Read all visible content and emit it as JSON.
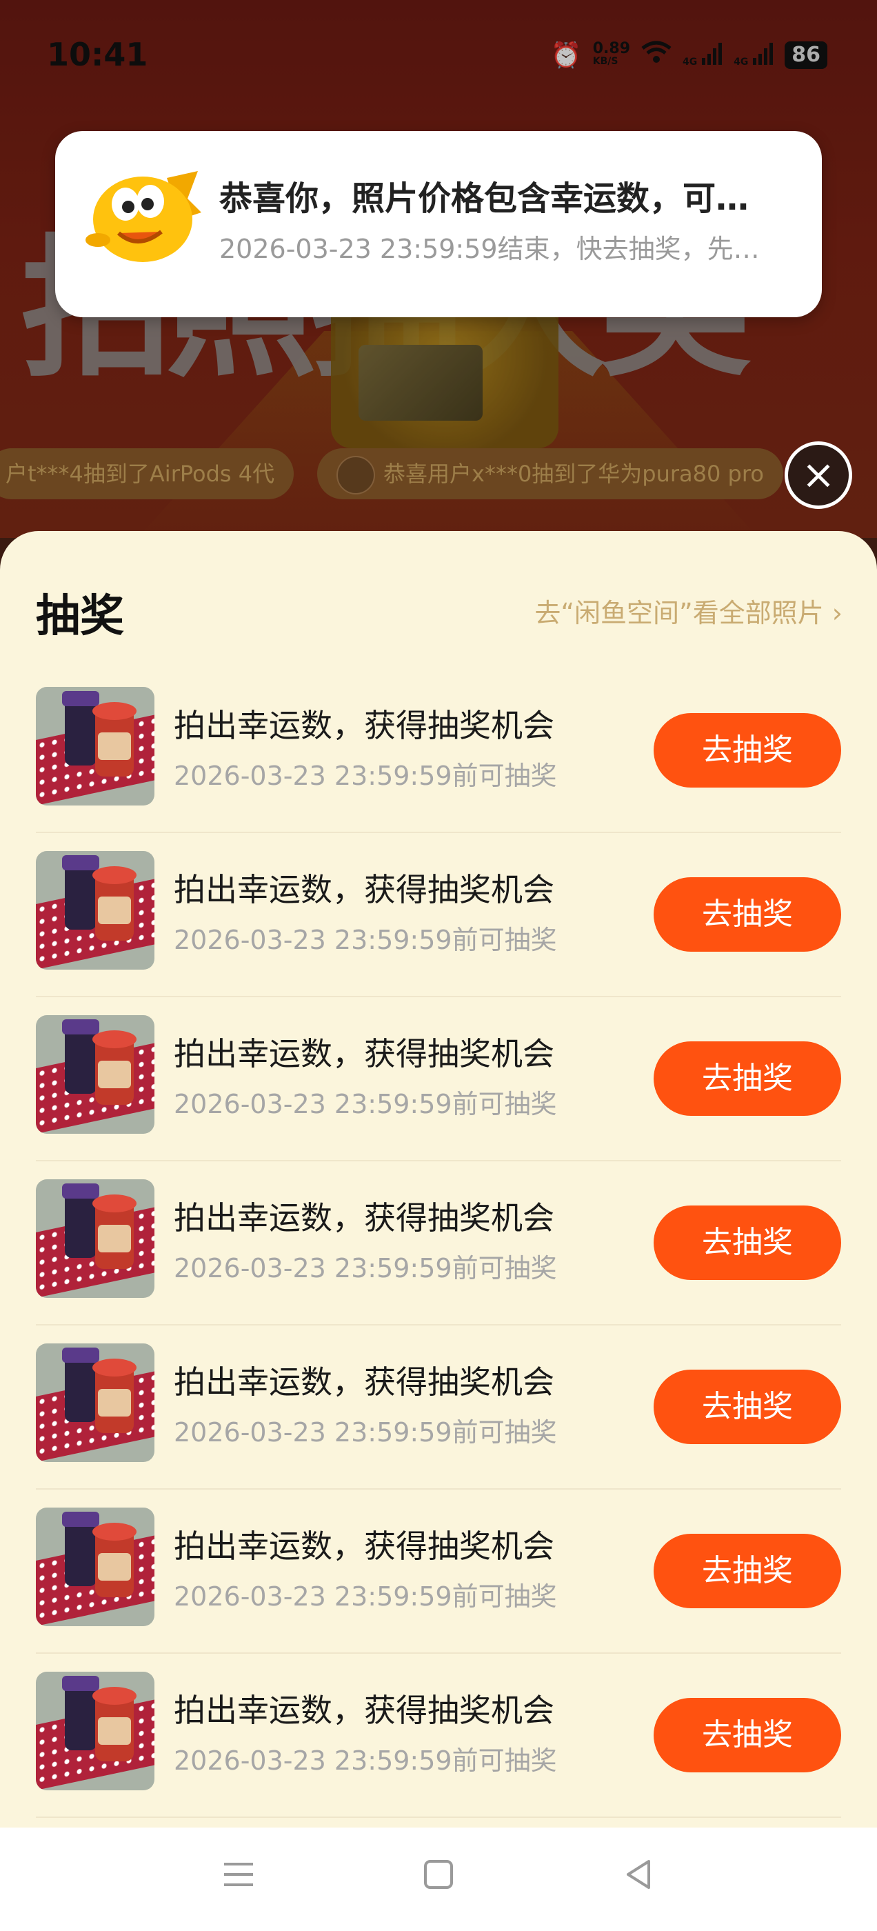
{
  "status_bar": {
    "time": "10:41",
    "speed_value": "0.89",
    "speed_unit": "KB/S",
    "net1": "4G",
    "net2": "4G",
    "battery": "86"
  },
  "background": {
    "hero_text": "拍照抽大奖",
    "ticker": [
      "户t***4抽到了AirPods 4代",
      "恭喜用户x***0抽到了华为pura80 pro"
    ]
  },
  "notification": {
    "title": "恭喜你，照片价格包含幸运数，可…",
    "body": "2026-03-23 23:59:59结束，快去抽奖，先…",
    "icon": "fish-mascot-icon"
  },
  "sheet": {
    "title": "抽奖",
    "link": "去“闲鱼空间”看全部照片",
    "items": [
      {
        "title": "拍出幸运数，获得抽奖机会",
        "subtitle": "2026-03-23 23:59:59前可抽奖",
        "button": "去抽奖"
      },
      {
        "title": "拍出幸运数，获得抽奖机会",
        "subtitle": "2026-03-23 23:59:59前可抽奖",
        "button": "去抽奖"
      },
      {
        "title": "拍出幸运数，获得抽奖机会",
        "subtitle": "2026-03-23 23:59:59前可抽奖",
        "button": "去抽奖"
      },
      {
        "title": "拍出幸运数，获得抽奖机会",
        "subtitle": "2026-03-23 23:59:59前可抽奖",
        "button": "去抽奖"
      },
      {
        "title": "拍出幸运数，获得抽奖机会",
        "subtitle": "2026-03-23 23:59:59前可抽奖",
        "button": "去抽奖"
      },
      {
        "title": "拍出幸运数，获得抽奖机会",
        "subtitle": "2026-03-23 23:59:59前可抽奖",
        "button": "去抽奖"
      },
      {
        "title": "拍出幸运数，获得抽奖机会",
        "subtitle": "2026-03-23 23:59:59前可抽奖",
        "button": "去抽奖"
      }
    ]
  },
  "colors": {
    "accent": "#ff5210",
    "sheet_bg": "#fbf5dc",
    "link": "#c9ab72"
  },
  "navbar": {
    "menu": "menu-icon",
    "home": "home-icon",
    "back": "back-icon"
  }
}
